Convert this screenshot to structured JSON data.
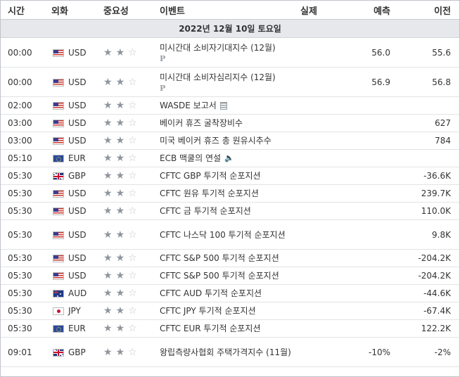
{
  "headers": {
    "time": "시간",
    "currency": "외화",
    "importance": "중요성",
    "event": "이벤트",
    "actual": "실제",
    "forecast": "예측",
    "previous": "이전"
  },
  "date_label": "2022년 12월 10일 토요일",
  "rows": [
    {
      "time": "00:00",
      "flag": "us",
      "currency": "USD",
      "stars": 2,
      "event": "미시간대 소비자기대지수 (12월)",
      "icon": "p-icon",
      "actual": "",
      "forecast": "56.0",
      "previous": "55.6"
    },
    {
      "time": "00:00",
      "flag": "us",
      "currency": "USD",
      "stars": 2,
      "event": "미시간대 소비자심리지수 (12월)",
      "icon": "p-icon",
      "actual": "",
      "forecast": "56.9",
      "previous": "56.8"
    },
    {
      "time": "02:00",
      "flag": "us",
      "currency": "USD",
      "stars": 2,
      "event": "WASDE 보고서",
      "icon": "document-icon",
      "actual": "",
      "forecast": "",
      "previous": ""
    },
    {
      "time": "03:00",
      "flag": "us",
      "currency": "USD",
      "stars": 2,
      "event": "베이커 휴즈 굴착장비수",
      "icon": "",
      "actual": "",
      "forecast": "",
      "previous": "627"
    },
    {
      "time": "03:00",
      "flag": "us",
      "currency": "USD",
      "stars": 2,
      "event": "미국 베이커 휴즈 총 원유시추수",
      "icon": "",
      "actual": "",
      "forecast": "",
      "previous": "784"
    },
    {
      "time": "05:10",
      "flag": "eu",
      "currency": "EUR",
      "stars": 2,
      "event": "ECB 맥쿨의 연설",
      "icon": "speaker-icon",
      "actual": "",
      "forecast": "",
      "previous": ""
    },
    {
      "time": "05:30",
      "flag": "gb",
      "currency": "GBP",
      "stars": 2,
      "event": "CFTC GBP 투기적 순포지션",
      "icon": "",
      "actual": "",
      "forecast": "",
      "previous": "-36.6K"
    },
    {
      "time": "05:30",
      "flag": "us",
      "currency": "USD",
      "stars": 2,
      "event": "CFTC 원유 투기적 순포지션",
      "icon": "",
      "actual": "",
      "forecast": "",
      "previous": "239.7K"
    },
    {
      "time": "05:30",
      "flag": "us",
      "currency": "USD",
      "stars": 2,
      "event": "CFTC 금 투기적 순포지션",
      "icon": "",
      "actual": "",
      "forecast": "",
      "previous": "110.0K"
    },
    {
      "time": "05:30",
      "flag": "us",
      "currency": "USD",
      "stars": 2,
      "event": "CFTC 나스닥 100 투기적 순포지션",
      "icon": "",
      "actual": "",
      "forecast": "",
      "previous": "9.8K"
    },
    {
      "time": "05:30",
      "flag": "us",
      "currency": "USD",
      "stars": 2,
      "event": "CFTC S&P 500 투기적 순포지션",
      "icon": "",
      "actual": "",
      "forecast": "",
      "previous": "-204.2K"
    },
    {
      "time": "05:30",
      "flag": "us",
      "currency": "USD",
      "stars": 2,
      "event": "CFTC S&P 500 투기적 순포지션",
      "icon": "",
      "actual": "",
      "forecast": "",
      "previous": "-204.2K"
    },
    {
      "time": "05:30",
      "flag": "au",
      "currency": "AUD",
      "stars": 2,
      "event": "CFTC AUD 투기적 순포지션",
      "icon": "",
      "actual": "",
      "forecast": "",
      "previous": "-44.6K"
    },
    {
      "time": "05:30",
      "flag": "jp",
      "currency": "JPY",
      "stars": 2,
      "event": "CFTC JPY 투기적 순포지션",
      "icon": "",
      "actual": "",
      "forecast": "",
      "previous": "-67.4K"
    },
    {
      "time": "05:30",
      "flag": "eu",
      "currency": "EUR",
      "stars": 2,
      "event": "CFTC EUR 투기적 순포지션",
      "icon": "",
      "actual": "",
      "forecast": "",
      "previous": "122.2K"
    },
    {
      "time": "09:01",
      "flag": "gb",
      "currency": "GBP",
      "stars": 2,
      "event": "왕립측량사협회 주택가격지수 (11월)",
      "icon": "",
      "actual": "",
      "forecast": "-10%",
      "previous": "-2%"
    }
  ],
  "star_total": 3,
  "colors": {
    "star_on": "#8f959c",
    "star_off": "#c3c7cc",
    "date_bar": "#e6e8eb",
    "border": "#bfc4ca"
  }
}
